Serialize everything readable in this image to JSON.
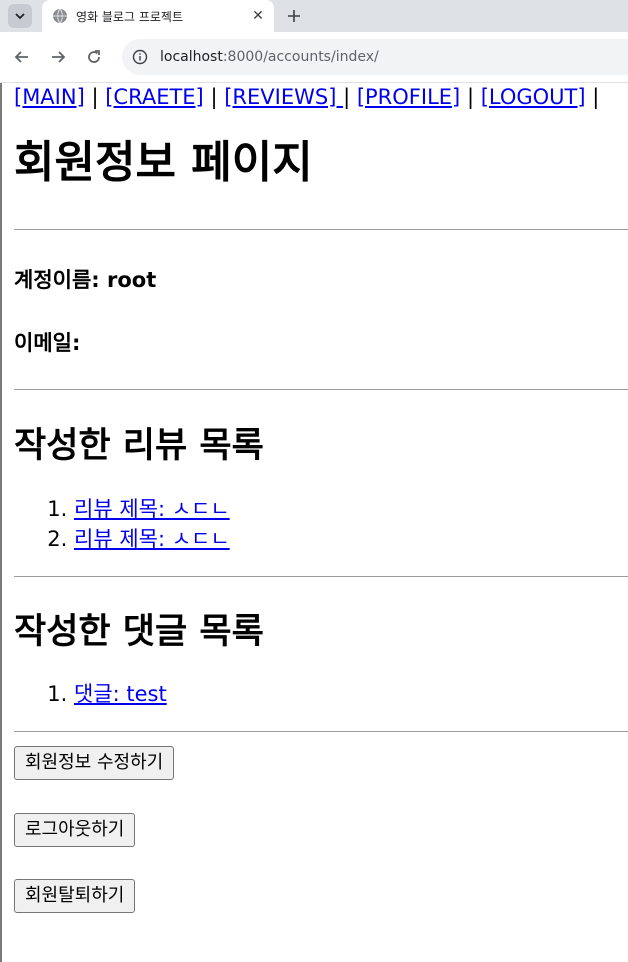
{
  "browser": {
    "tab_title": "영화 블로그 프로젝트",
    "url_host": "localhost",
    "url_rest": ":8000/accounts/index/"
  },
  "nav": {
    "main": "[MAIN]",
    "create": "[CRAETE]",
    "reviews": "[REVIEWS] ",
    "profile": "[PROFILE]",
    "logout": "[LOGOUT]",
    "separator": "|"
  },
  "page": {
    "title": "회원정보 페이지",
    "username_label": "계정이름: root",
    "email_label": "이메일:"
  },
  "reviews_section": {
    "title": "작성한 리뷰 목록",
    "items": [
      {
        "label": "리뷰 제목: ㅅㄷㄴ"
      },
      {
        "label": "리뷰 제목: ㅅㄷㄴ"
      }
    ]
  },
  "comments_section": {
    "title": "작성한 댓글 목록",
    "items": [
      {
        "label": "댓글: test"
      }
    ]
  },
  "buttons": {
    "edit": "회원정보 수정하기",
    "logout": "로그아웃하기",
    "withdraw": "회원탈퇴하기"
  }
}
